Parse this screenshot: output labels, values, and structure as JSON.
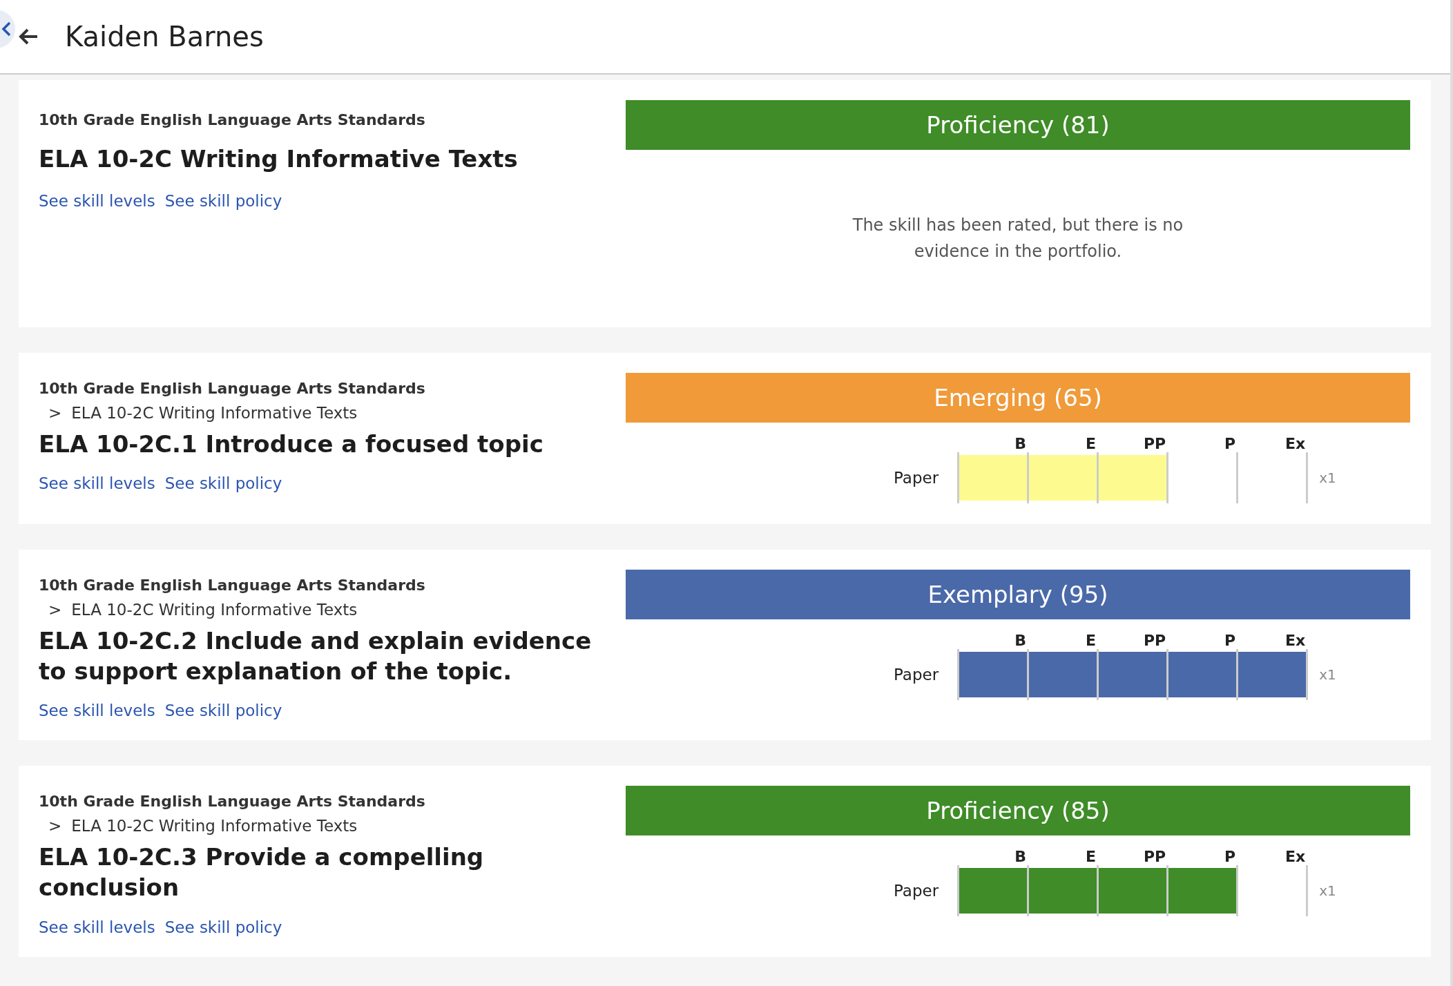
{
  "header": {
    "title": "Kaiden Barnes"
  },
  "skills": [
    {
      "standard": "10th Grade English Language Arts Standards",
      "title": "ELA 10-2C Writing Informative Texts",
      "links": [
        "See skill levels",
        "See skill policy"
      ],
      "rating": {
        "label": "Proficiency (81)",
        "color": "#3f8c28"
      },
      "kind": "message",
      "message": "The skill has been rated, but there is no evidence in the portfolio."
    },
    {
      "standard": "10th Grade English Language Arts Standards",
      "breadcrumb": {
        "separator": ">",
        "text": "ELA 10-2C Writing Informative Texts"
      },
      "title": "ELA 10-2C.1 Introduce a focused topic",
      "links": [
        "See skill levels",
        "See skill policy"
      ],
      "rating": {
        "label": "Emerging (65)",
        "color": "#f09a3a"
      },
      "kind": "chart",
      "levels": [
        "B",
        "E",
        "PP",
        "P",
        "Ex"
      ],
      "rows": [
        {
          "name": "Paper",
          "level": 0.6,
          "color": "#fdfb8f",
          "count": "x1"
        }
      ]
    },
    {
      "standard": "10th Grade English Language Arts Standards",
      "breadcrumb": {
        "separator": ">",
        "text": "ELA 10-2C Writing Informative Texts"
      },
      "title": "ELA 10-2C.2 Include and explain evidence to support explanation of the topic.",
      "links": [
        "See skill levels",
        "See skill policy"
      ],
      "rating": {
        "label": "Exemplary (95)",
        "color": "#4a69a8"
      },
      "kind": "chart",
      "levels": [
        "B",
        "E",
        "PP",
        "P",
        "Ex"
      ],
      "rows": [
        {
          "name": "Paper",
          "level": 1,
          "color": "#4a69a8",
          "count": "x1"
        }
      ]
    },
    {
      "standard": "10th Grade English Language Arts Standards",
      "breadcrumb": {
        "separator": ">",
        "text": "ELA 10-2C Writing Informative Texts"
      },
      "title": "ELA 10-2C.3 Provide a compelling conclusion",
      "links": [
        "See skill levels",
        "See skill policy"
      ],
      "rating": {
        "label": "Proficiency (85)",
        "color": "#3f8c28"
      },
      "kind": "chart",
      "levels": [
        "B",
        "E",
        "PP",
        "P",
        "Ex"
      ],
      "rows": [
        {
          "name": "Paper",
          "level": 0.8,
          "color": "#3f8c28",
          "count": "x1"
        }
      ]
    }
  ]
}
